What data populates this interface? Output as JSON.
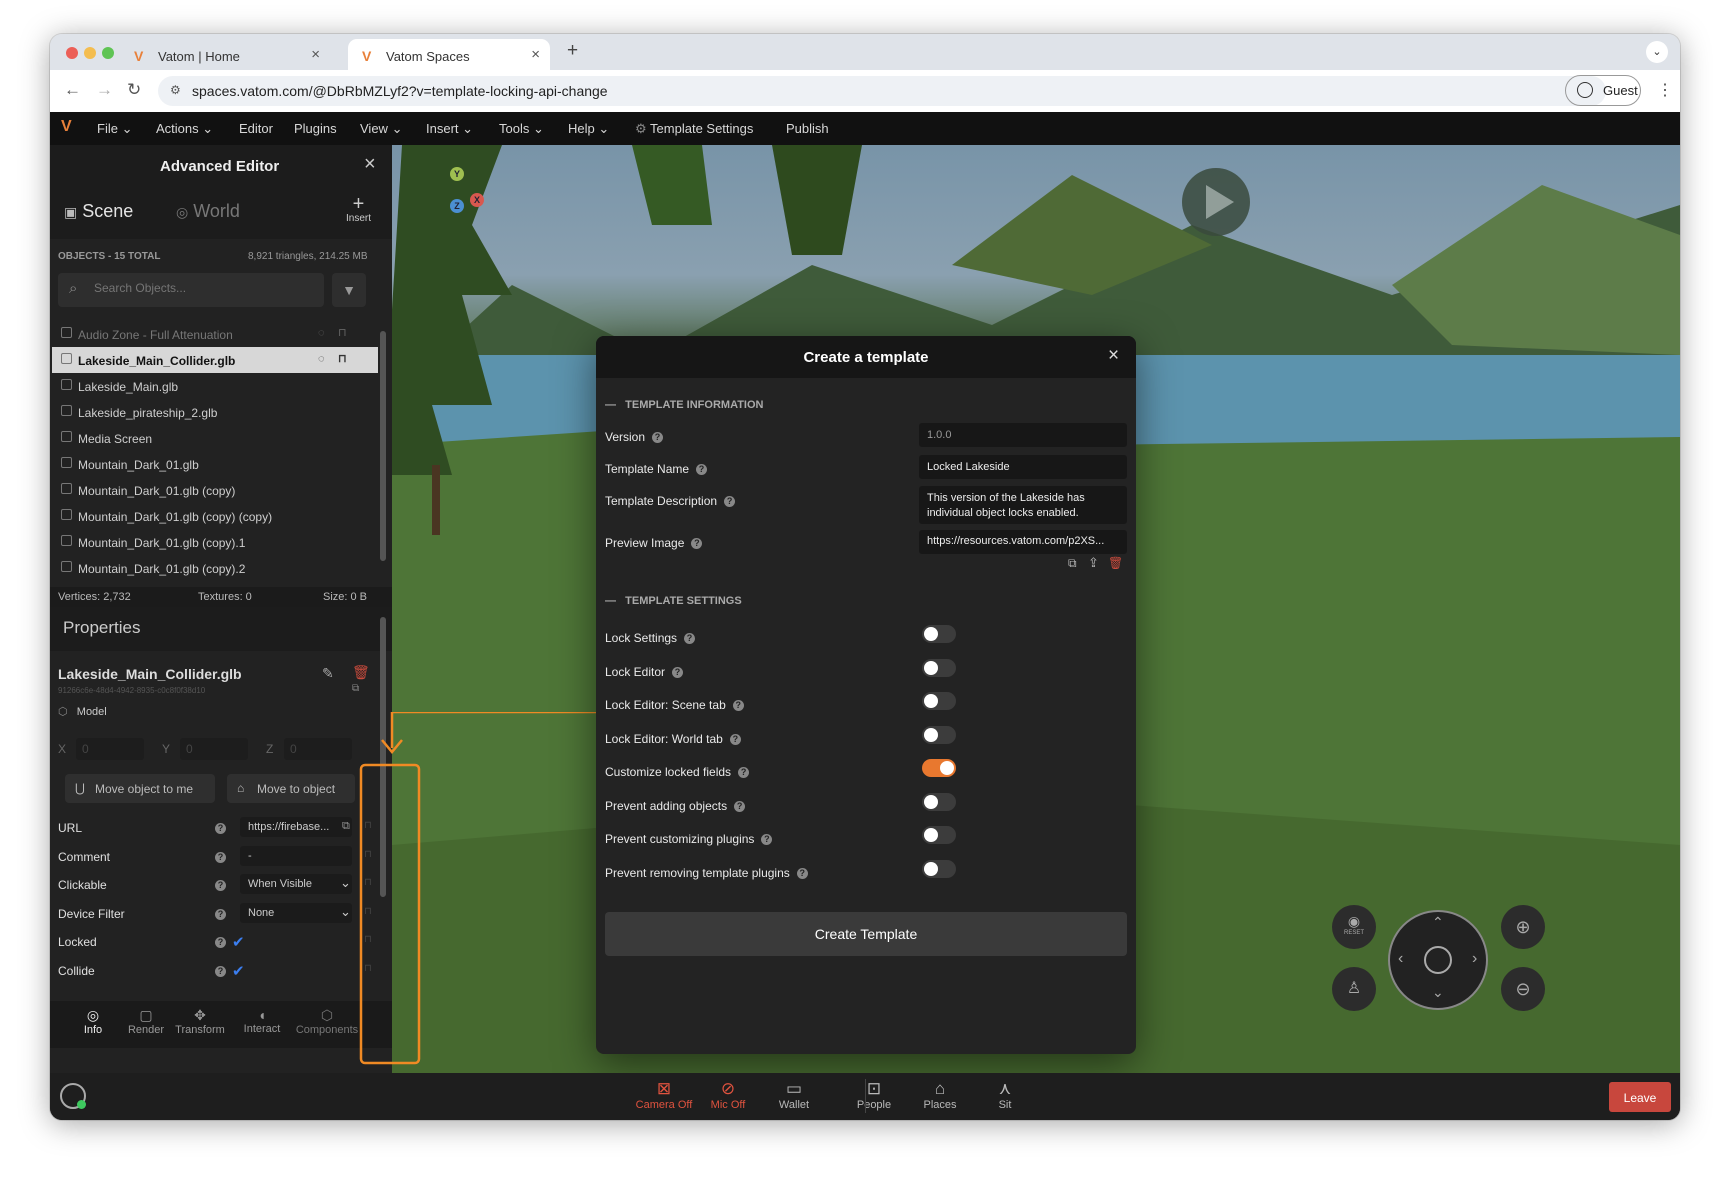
{
  "browser": {
    "tabs": [
      {
        "title": "Vatom | Home",
        "active": false
      },
      {
        "title": "Vatom Spaces",
        "active": true
      }
    ],
    "url": "spaces.vatom.com/@DbRbMZLyf2?v=template-locking-api-change",
    "profile_label": "Guest"
  },
  "menubar": {
    "items": [
      "File",
      "Actions",
      "Editor",
      "Plugins",
      "View",
      "Insert",
      "Tools",
      "Help",
      "Template Settings",
      "Publish"
    ]
  },
  "editor": {
    "title": "Advanced Editor",
    "tabs": [
      "Scene",
      "World"
    ],
    "insert_label": "Insert",
    "objects_header": "OBJECTS - 15 TOTAL",
    "objects_stats": "8,921 triangles, 214.25 MB",
    "search_placeholder": "Search Objects...",
    "objects": [
      {
        "name": "Audio Zone - Full Attenuation",
        "selected": false,
        "dim": true
      },
      {
        "name": "Lakeside_Main_Collider.glb",
        "selected": true
      },
      {
        "name": "Lakeside_Main.glb"
      },
      {
        "name": "Lakeside_pirateship_2.glb"
      },
      {
        "name": "Media Screen"
      },
      {
        "name": "Mountain_Dark_01.glb"
      },
      {
        "name": "Mountain_Dark_01.glb (copy)"
      },
      {
        "name": "Mountain_Dark_01.glb (copy) (copy)"
      },
      {
        "name": "Mountain_Dark_01.glb (copy).1"
      },
      {
        "name": "Mountain_Dark_01.glb (copy).2"
      }
    ],
    "stats": {
      "vertices": "Vertices: 2,732",
      "textures": "Textures: 0",
      "size": "Size: 0 B"
    },
    "properties_title": "Properties",
    "object_name": "Lakeside_Main_Collider.glb",
    "object_id": "91266c6e-48d4-4942-8935-c0c8f0f38d10",
    "object_type": "Model",
    "coords": {
      "x_label": "X",
      "y_label": "Y",
      "z_label": "Z",
      "x": "0",
      "y": "0",
      "z": "0"
    },
    "move_to_me_label": "Move object to me",
    "move_to_object_label": "Move to object",
    "props": [
      {
        "label": "URL",
        "value": "https://firebase..."
      },
      {
        "label": "Comment",
        "value": "-"
      },
      {
        "label": "Clickable",
        "value": "When Visible"
      },
      {
        "label": "Device Filter",
        "value": "None"
      },
      {
        "label": "Locked",
        "checked": true
      },
      {
        "label": "Collide",
        "checked": true
      }
    ],
    "bottom_tabs": [
      "Info",
      "Render",
      "Transform",
      "Interact",
      "Components"
    ]
  },
  "modal": {
    "title": "Create a template",
    "section_info": "TEMPLATE INFORMATION",
    "version_label": "Version",
    "version_value": "1.0.0",
    "name_label": "Template Name",
    "name_value": "Locked Lakeside",
    "description_label": "Template Description",
    "description_value": "This version of the Lakeside has individual object locks enabled.",
    "preview_label": "Preview Image",
    "preview_value": "https://resources.vatom.com/p2XS...",
    "section_settings": "TEMPLATE SETTINGS",
    "settings": [
      {
        "label": "Lock Settings",
        "on": false
      },
      {
        "label": "Lock Editor",
        "on": false
      },
      {
        "label": "Lock Editor: Scene tab",
        "on": false
      },
      {
        "label": "Lock Editor: World tab",
        "on": false
      },
      {
        "label": "Customize locked fields",
        "on": true
      },
      {
        "label": "Prevent adding objects",
        "on": false
      },
      {
        "label": "Prevent customizing plugins",
        "on": false
      },
      {
        "label": "Prevent removing template plugins",
        "on": false
      }
    ],
    "create_button_label": "Create Template"
  },
  "bottombar": {
    "items": [
      {
        "label": "Camera Off",
        "icon": "camera-off-icon",
        "color": "#e0533f"
      },
      {
        "label": "Mic Off",
        "icon": "mic-off-icon",
        "color": "#e0533f"
      },
      {
        "label": "Wallet",
        "icon": "wallet-icon",
        "color": "#b9b9b9"
      },
      {
        "label": "People",
        "icon": "people-icon",
        "color": "#b9b9b9"
      },
      {
        "label": "Places",
        "icon": "map-icon",
        "color": "#b9b9b9"
      },
      {
        "label": "Sit",
        "icon": "sit-icon",
        "color": "#b9b9b9"
      }
    ],
    "leave_label": "Leave"
  },
  "colors": {
    "accent": "#e8782f",
    "danger": "#c94b3d",
    "leave": "#c8473d",
    "check": "#3b7ef0"
  },
  "controls": {
    "reset_label": "RESET"
  }
}
